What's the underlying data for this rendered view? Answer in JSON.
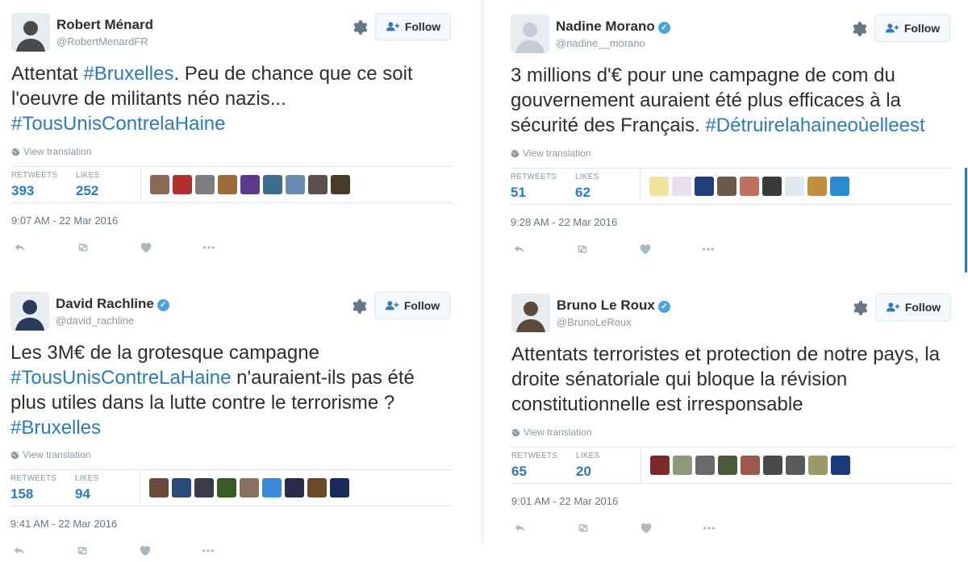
{
  "tweets": [
    {
      "name": "Robert Ménard",
      "verified": false,
      "handle": "@RobertMenardFR",
      "follow_label": "Follow",
      "body_parts": [
        {
          "t": "Attentat ",
          "tag": false
        },
        {
          "t": "#Bruxelles",
          "tag": true
        },
        {
          "t": ". Peu de chance que ce soit l'oeuvre de militants néo nazis... ",
          "tag": false
        },
        {
          "t": "#TousUnisContrelaHaine",
          "tag": true
        }
      ],
      "view_translation": "View translation",
      "retweets_label": "RETWEETS",
      "retweets": "393",
      "likes_label": "LIKES",
      "likes": "252",
      "likers": [
        "#8a6a55",
        "#b03030",
        "#7d7d7d",
        "#9c6b3c",
        "#5b3a8c",
        "#3e6e8e",
        "#6a8bb0",
        "#5a5050",
        "#4a3a2a"
      ],
      "timestamp": "9:07 AM - 22 Mar 2016",
      "avatar_color": "#4a4a4a"
    },
    {
      "name": "Nadine Morano",
      "verified": true,
      "handle": "@nadine__morano",
      "follow_label": "Follow",
      "body_parts": [
        {
          "t": "3 millions d'€ pour une campagne de com du gouvernement auraient été plus efficaces à la sécurité des Français. ",
          "tag": false
        },
        {
          "t": "#Détruirelahaineoùelleest",
          "tag": true
        }
      ],
      "view_translation": "View translation",
      "retweets_label": "RETWEETS",
      "retweets": "51",
      "likes_label": "LIKES",
      "likes": "62",
      "likers": [
        "#f3e3a0",
        "#e8e0f0",
        "#1f3f7a",
        "#6b5a4a",
        "#c07060",
        "#3a3a3a",
        "#e0e8f0",
        "#c09040",
        "#2a8ad0"
      ],
      "timestamp": "9:28 AM - 22 Mar 2016",
      "avatar_color": "#c9c9d8"
    },
    {
      "name": "David Rachline",
      "verified": true,
      "handle": "@david_rachline",
      "follow_label": "Follow",
      "body_parts": [
        {
          "t": "Les 3M€ de la grotesque campagne ",
          "tag": false
        },
        {
          "t": "#TousUnisContreLaHaine",
          "tag": true
        },
        {
          "t": " n'auraient-ils pas été plus utiles dans la lutte contre le terrorisme ? ",
          "tag": false
        },
        {
          "t": "#Bruxelles",
          "tag": true
        }
      ],
      "view_translation": "View translation",
      "retweets_label": "RETWEETS",
      "retweets": "158",
      "likes_label": "LIKES",
      "likes": "94",
      "likers": [
        "#6a4a3a",
        "#2a4a7a",
        "#3a3a4a",
        "#3a5a2a",
        "#8a7060",
        "#3a8ad8",
        "#2a2a4a",
        "#6a4a2a",
        "#1a2a5a"
      ],
      "timestamp": "9:41 AM - 22 Mar 2016",
      "avatar_color": "#2a3a5a"
    },
    {
      "name": "Bruno Le Roux",
      "verified": true,
      "handle": "@BrunoLeRoux",
      "follow_label": "Follow",
      "body_parts": [
        {
          "t": "Attentats terroristes et protection de notre pays, la droite sénatoriale qui bloque la révision constitutionnelle est irresponsable",
          "tag": false
        }
      ],
      "view_translation": "View translation",
      "retweets_label": "RETWEETS",
      "retweets": "65",
      "likes_label": "LIKES",
      "likes": "20",
      "likers": [
        "#7a2a2a",
        "#8a9a7a",
        "#6a6a6a",
        "#4a5a3a",
        "#9a5a4a",
        "#4a4a4a",
        "#5a5a5a",
        "#9a9a6a",
        "#1a3a7a"
      ],
      "timestamp": "9:01 AM - 22 Mar 2016",
      "avatar_color": "#5a4a3a"
    }
  ]
}
